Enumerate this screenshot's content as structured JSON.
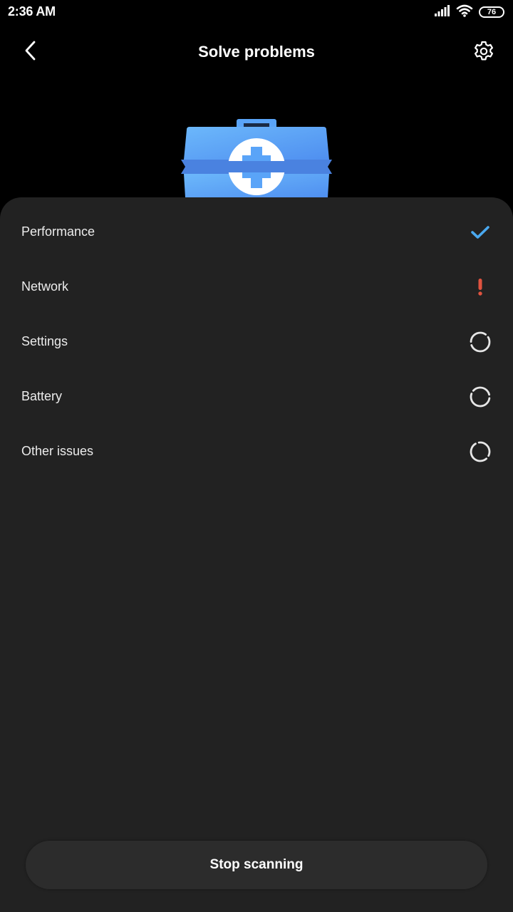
{
  "status_bar": {
    "time": "2:36 AM",
    "battery_level": "76",
    "icons": [
      "signal-icon",
      "wifi-icon",
      "battery-icon"
    ]
  },
  "header": {
    "title": "Solve problems",
    "back_icon": "chevron-left-icon",
    "settings_icon": "gear-icon"
  },
  "hero": {
    "icon": "toolbox-icon",
    "colors": {
      "box": "#5aa4f8",
      "band": "#4d87e4",
      "cross_circle": "#ffffff"
    }
  },
  "scan": {
    "items": [
      {
        "label": "Performance",
        "status": "done",
        "icon": "checkmark-icon"
      },
      {
        "label": "Network",
        "status": "issue",
        "icon": "exclamation-icon"
      },
      {
        "label": "Settings",
        "status": "scanning",
        "icon": "spinner-icon"
      },
      {
        "label": "Battery",
        "status": "scanning",
        "icon": "spinner-icon"
      },
      {
        "label": "Other issues",
        "status": "scanning",
        "icon": "spinner-icon"
      }
    ],
    "status_colors": {
      "done": "#4aa9f0",
      "issue": "#e0533f",
      "scanning": "#e6e6e6"
    }
  },
  "footer": {
    "stop_label": "Stop scanning"
  }
}
